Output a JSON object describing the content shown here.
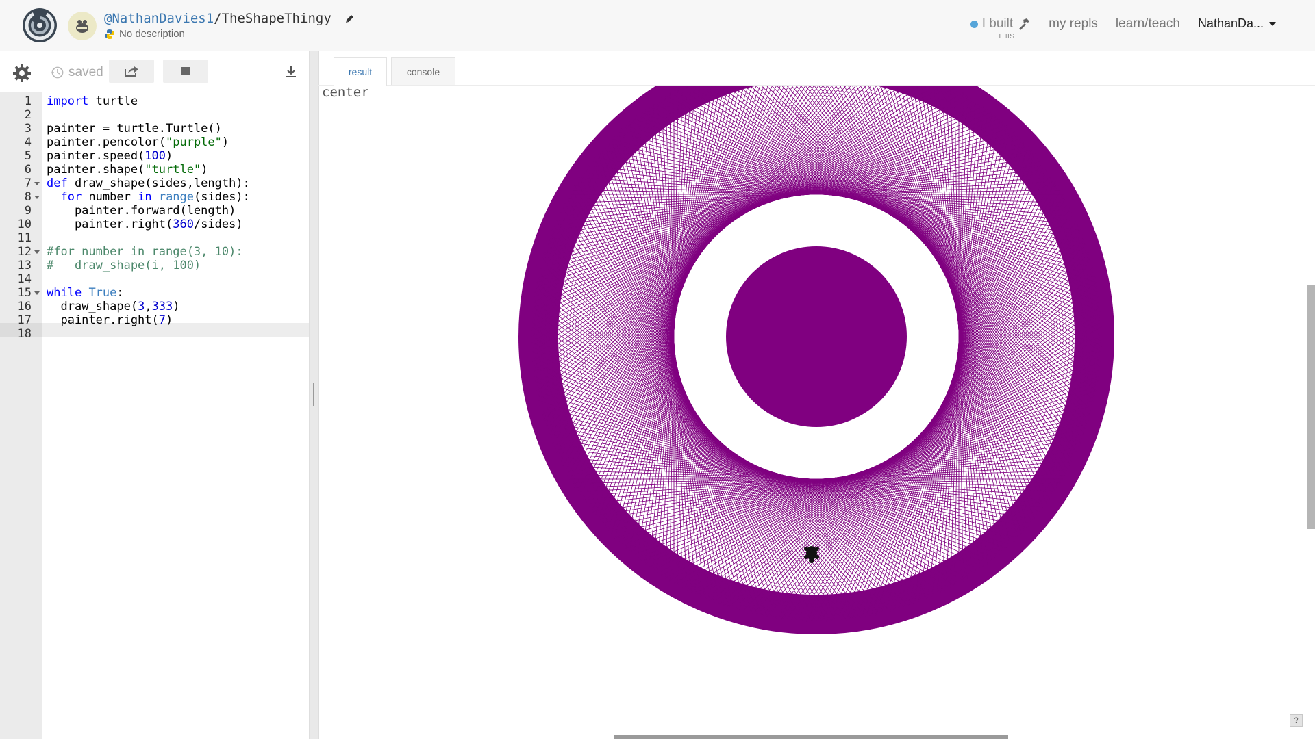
{
  "header": {
    "owner": "@NathanDavies1",
    "separator": "/",
    "repl_name": "TheShapeThingy",
    "description": "No description",
    "built_label": "I built",
    "built_sub": "THIS",
    "my_repls": "my repls",
    "learn_teach": "learn/teach",
    "user": "NathanDa..."
  },
  "toolbar": {
    "saved_label": "saved"
  },
  "editor": {
    "line_numbers": [
      "1",
      "2",
      "3",
      "4",
      "5",
      "6",
      "7",
      "8",
      "9",
      "10",
      "11",
      "12",
      "13",
      "14",
      "15",
      "16",
      "17",
      "18"
    ],
    "active_line": "18"
  },
  "result": {
    "tabs": [
      "result",
      "console"
    ],
    "active_tab": "result",
    "output_text": "center",
    "pen_color": "purple",
    "help_label": "?"
  },
  "colors": {
    "accent": "#3b77b0",
    "pen": "#800080",
    "status_dot": "#56a5d9"
  },
  "icons": [
    "logo-icon",
    "avatar-icon",
    "pencil-icon",
    "python-icon",
    "hammer-icon",
    "gear-icon",
    "history-icon",
    "share-icon",
    "stop-icon",
    "download-icon",
    "turtle-icon"
  ]
}
